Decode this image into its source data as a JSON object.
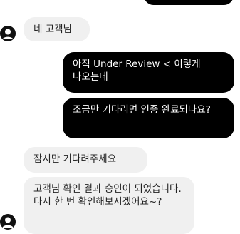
{
  "colors": {
    "outgoing_bg": "#000000",
    "outgoing_text": "#ffffff",
    "incoming_bg": "#f0f0f0",
    "incoming_text": "#222222"
  },
  "avatar_icon": "user-avatar-icon",
  "messages": [
    {
      "direction": "outgoing",
      "text": ""
    },
    {
      "direction": "incoming",
      "text": "네 고객님"
    },
    {
      "direction": "outgoing",
      "text": "아직 Under Review < 이렇게 나오는데"
    },
    {
      "direction": "outgoing",
      "text": "조금만 기다리면 인증 완료되나요?"
    },
    {
      "direction": "incoming",
      "text": "잠시만 기다려주세요"
    },
    {
      "direction": "incoming",
      "text": "고객님 확인 결과 승인이 되었습니다. 다시 한 번 확인해보시겠어요~?"
    }
  ]
}
